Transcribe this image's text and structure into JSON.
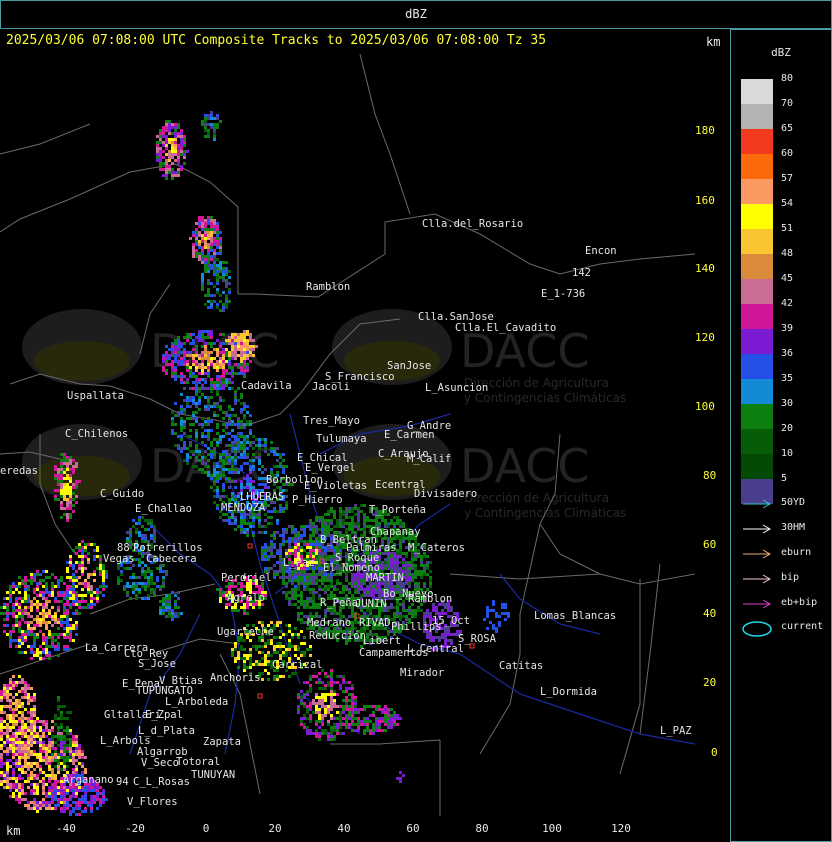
{
  "window": {
    "title": "dBZ"
  },
  "header": {
    "text": "2025/03/06 07:08:00 UTC Composite Tracks to 2025/03/06 07:08:00 Tz 35",
    "km_label": "km"
  },
  "axes": {
    "x_label": "km",
    "x_ticks": [
      "-40",
      "-20",
      "0",
      "20",
      "40",
      "60",
      "80",
      "100",
      "120"
    ],
    "y_ticks": [
      "180",
      "160",
      "140",
      "120",
      "100",
      "80",
      "60",
      "40",
      "20",
      "0"
    ]
  },
  "legend": {
    "title": "dBZ",
    "scale": [
      {
        "label": "80",
        "color": "#d9d9d9"
      },
      {
        "label": "70",
        "color": "#b3b3b3"
      },
      {
        "label": "65",
        "color": "#f23a1e"
      },
      {
        "label": "60",
        "color": "#fa6a0a"
      },
      {
        "label": "57",
        "color": "#fb9960"
      },
      {
        "label": "54",
        "color": "#ffff00"
      },
      {
        "label": "51",
        "color": "#fbc531"
      },
      {
        "label": "48",
        "color": "#d98a3a"
      },
      {
        "label": "45",
        "color": "#c96d96"
      },
      {
        "label": "42",
        "color": "#d11698"
      },
      {
        "label": "39",
        "color": "#7b1bd3"
      },
      {
        "label": "36",
        "color": "#2450e8"
      },
      {
        "label": "35",
        "color": "#128ad6"
      },
      {
        "label": "30",
        "color": "#0d7f10"
      },
      {
        "label": "20",
        "color": "#075c07"
      },
      {
        "label": "10",
        "color": "#044a04"
      },
      {
        "label": "5",
        "color": "#4a3f8f"
      }
    ],
    "tracks": [
      {
        "label": "50YD",
        "color": "#32c3c8"
      },
      {
        "label": "30HM",
        "color": "#ffffff"
      },
      {
        "label": "eburn",
        "color": "#f0b070"
      },
      {
        "label": "bip",
        "color": "#f2c9e0"
      },
      {
        "label": "eb+bip",
        "color": "#e040d0"
      }
    ],
    "current": {
      "label": "current",
      "color": "#20d8e8"
    }
  },
  "watermark": {
    "brand": "DACC",
    "line1": "Dirección de Agricultura",
    "line2": "y Contingencias Climáticas"
  },
  "places": [
    {
      "name": "Clla.del_Rosario",
      "x": 422,
      "y": 173
    },
    {
      "name": "Encon",
      "x": 585,
      "y": 200
    },
    {
      "name": "142",
      "x": 572,
      "y": 222
    },
    {
      "name": "E_1-736",
      "x": 541,
      "y": 243
    },
    {
      "name": "Ramblon",
      "x": 306,
      "y": 236
    },
    {
      "name": "Clla.SanJose",
      "x": 418,
      "y": 266
    },
    {
      "name": "Clla.El_Cavadito",
      "x": 455,
      "y": 277
    },
    {
      "name": "S_Francisco",
      "x": 325,
      "y": 326
    },
    {
      "name": "SanJose",
      "x": 387,
      "y": 315
    },
    {
      "name": "Jacoli",
      "x": 312,
      "y": 336
    },
    {
      "name": "L_Asuncion",
      "x": 425,
      "y": 337
    },
    {
      "name": "Uspallata",
      "x": 67,
      "y": 345
    },
    {
      "name": "Cadavila",
      "x": 241,
      "y": 335
    },
    {
      "name": "Tres_Mayo",
      "x": 303,
      "y": 370
    },
    {
      "name": "G_Andre",
      "x": 407,
      "y": 375
    },
    {
      "name": "C_Chilenos",
      "x": 65,
      "y": 383
    },
    {
      "name": "Tulumaya",
      "x": 316,
      "y": 388
    },
    {
      "name": "E_Carmen",
      "x": 384,
      "y": 384
    },
    {
      "name": "C_Araujo",
      "x": 378,
      "y": 403
    },
    {
      "name": "E_Chical",
      "x": 297,
      "y": 407
    },
    {
      "name": "M_Calif",
      "x": 407,
      "y": 408
    },
    {
      "name": "E_Vergel",
      "x": 305,
      "y": 417
    },
    {
      "name": "eredas",
      "x": 0,
      "y": 420
    },
    {
      "name": "Borbollon",
      "x": 266,
      "y": 429
    },
    {
      "name": "E_Violetas",
      "x": 304,
      "y": 435
    },
    {
      "name": "Ecentral",
      "x": 375,
      "y": 434
    },
    {
      "name": "Divisadero",
      "x": 414,
      "y": 443
    },
    {
      "name": "C_Guido",
      "x": 100,
      "y": 443
    },
    {
      "name": "P_Hierro",
      "x": 292,
      "y": 449
    },
    {
      "name": "E_Challao",
      "x": 135,
      "y": 458
    },
    {
      "name": "LHUERAS",
      "x": 240,
      "y": 446
    },
    {
      "name": "MENDOZA",
      "x": 221,
      "y": 457
    },
    {
      "name": "T_Porteña",
      "x": 369,
      "y": 459
    },
    {
      "name": "Chapanay",
      "x": 370,
      "y": 481
    },
    {
      "name": "B_Beltran",
      "x": 320,
      "y": 489
    },
    {
      "name": "Palmiras",
      "x": 346,
      "y": 497
    },
    {
      "name": "M_Cateros",
      "x": 408,
      "y": 497
    },
    {
      "name": "88",
      "x": 117,
      "y": 497
    },
    {
      "name": "Potrerillos",
      "x": 133,
      "y": 497
    },
    {
      "name": "S_Roque",
      "x": 335,
      "y": 507
    },
    {
      "name": "Vegas",
      "x": 103,
      "y": 508
    },
    {
      "name": "Cabecera",
      "x": 146,
      "y": 508
    },
    {
      "name": "L_Paz",
      "x": 283,
      "y": 512
    },
    {
      "name": "El_Nomeno",
      "x": 323,
      "y": 517
    },
    {
      "name": "MARTIN",
      "x": 366,
      "y": 527
    },
    {
      "name": "Perdriel",
      "x": 221,
      "y": 527
    },
    {
      "name": "Bo_Nuevo",
      "x": 383,
      "y": 543
    },
    {
      "name": "Ramblon",
      "x": 408,
      "y": 548
    },
    {
      "name": "Agrelo",
      "x": 227,
      "y": 547
    },
    {
      "name": "R_Peña",
      "x": 320,
      "y": 552
    },
    {
      "name": "JUNIN",
      "x": 355,
      "y": 553
    },
    {
      "name": "Lomas_Blancas",
      "x": 534,
      "y": 565
    },
    {
      "name": "Medrano",
      "x": 307,
      "y": 572
    },
    {
      "name": "RIVAD",
      "x": 359,
      "y": 572
    },
    {
      "name": "Phillips",
      "x": 391,
      "y": 576
    },
    {
      "name": "15_Oct",
      "x": 432,
      "y": 570
    },
    {
      "name": "Reducción",
      "x": 309,
      "y": 585
    },
    {
      "name": "Ugarteche",
      "x": 217,
      "y": 581
    },
    {
      "name": "Libert",
      "x": 363,
      "y": 590
    },
    {
      "name": "S_ROSA",
      "x": 458,
      "y": 588
    },
    {
      "name": "La_Carrera",
      "x": 85,
      "y": 597
    },
    {
      "name": "Campamentos",
      "x": 359,
      "y": 602
    },
    {
      "name": "L_Central",
      "x": 407,
      "y": 598
    },
    {
      "name": "Cto_Rey",
      "x": 124,
      "y": 603
    },
    {
      "name": "S_Jose",
      "x": 138,
      "y": 613
    },
    {
      "name": "Catitas",
      "x": 499,
      "y": 615
    },
    {
      "name": "Carrizal",
      "x": 272,
      "y": 614
    },
    {
      "name": "Mirador",
      "x": 400,
      "y": 622
    },
    {
      "name": "Anchoris",
      "x": 210,
      "y": 627
    },
    {
      "name": "V_Btias",
      "x": 159,
      "y": 630
    },
    {
      "name": "E_Pena",
      "x": 122,
      "y": 633
    },
    {
      "name": "TUPUNGATO",
      "x": 136,
      "y": 640
    },
    {
      "name": "L_Dormida",
      "x": 540,
      "y": 641
    },
    {
      "name": "L_Arboleda",
      "x": 165,
      "y": 651
    },
    {
      "name": "Gltallarí",
      "x": 104,
      "y": 664
    },
    {
      "name": "E_Zpal",
      "x": 145,
      "y": 664
    },
    {
      "name": "L_d_Plata",
      "x": 138,
      "y": 680
    },
    {
      "name": "L_PAZ",
      "x": 660,
      "y": 680
    },
    {
      "name": "L_Arbols",
      "x": 100,
      "y": 690
    },
    {
      "name": "Zapata",
      "x": 203,
      "y": 691
    },
    {
      "name": "Algarrob",
      "x": 137,
      "y": 701
    },
    {
      "name": "V_Seco",
      "x": 141,
      "y": 712
    },
    {
      "name": "Totoral",
      "x": 176,
      "y": 711
    },
    {
      "name": "TUNUYAN",
      "x": 191,
      "y": 724
    },
    {
      "name": "Arganano",
      "x": 63,
      "y": 729
    },
    {
      "name": "94",
      "x": 116,
      "y": 731
    },
    {
      "name": "C_L_Rosas",
      "x": 133,
      "y": 731
    },
    {
      "name": "V_Flores",
      "x": 127,
      "y": 751
    }
  ]
}
